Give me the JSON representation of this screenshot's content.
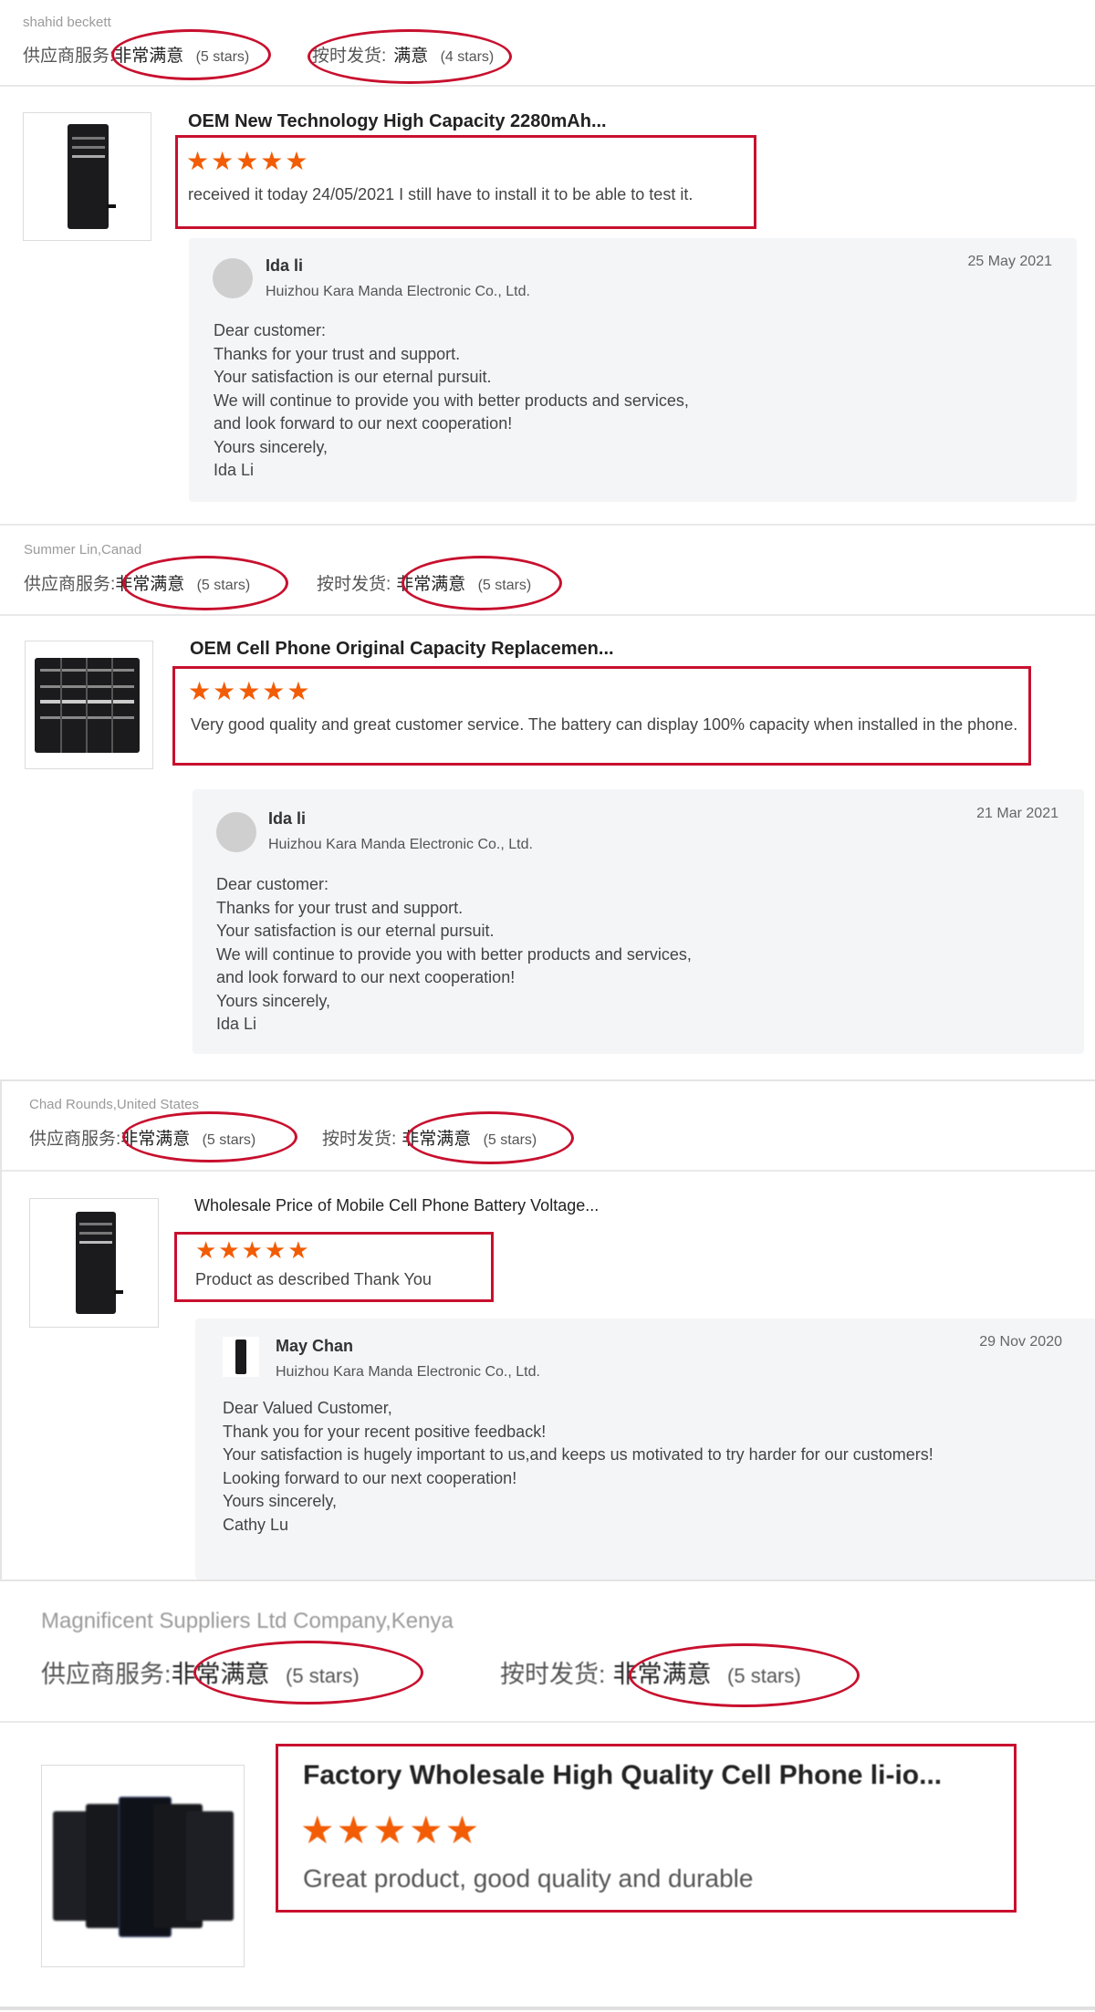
{
  "reviews": [
    {
      "reviewer": "shahid beckett",
      "service_label": "供应商服务:",
      "service_value": "非常满意",
      "service_count": "(5 stars)",
      "shipping_label": "按时发货:",
      "shipping_value": "满意",
      "shipping_count": "(4 stars)",
      "product_title": "OEM New Technology High Capacity 2280mAh...",
      "rating": 5,
      "stars": "★★★★★",
      "comment": "received it today 24/05/2021 I still have to install it to be able to test it.",
      "reply": {
        "name": "Ida li",
        "company": "Huizhou Kara Manda Electronic Co., Ltd.",
        "date": "25 May 2021",
        "message": "Dear customer:\nThanks for your trust and support.\nYour satisfaction is our eternal pursuit.\nWe will continue to provide you with better products and services,\nand look forward to our next cooperation!\nYours sincerely,\nIda Li"
      }
    },
    {
      "reviewer": "Summer Lin,Canad",
      "service_label": "供应商服务:",
      "service_value": "非常满意",
      "service_count": "(5 stars)",
      "shipping_label": "按时发货:",
      "shipping_value": "非常满意",
      "shipping_count": "(5 stars)",
      "product_title": "OEM Cell Phone Original Capacity Replacemen...",
      "rating": 5,
      "stars": "★★★★★",
      "comment": "Very good quality and great customer service. The battery can display 100% capacity when installed in the phone.",
      "reply": {
        "name": "Ida li",
        "company": "Huizhou Kara Manda Electronic Co., Ltd.",
        "date": "21 Mar 2021",
        "message": "Dear customer:\nThanks for your trust and support.\nYour satisfaction is our eternal pursuit.\nWe will continue to provide you with better products and services,\nand look forward to our next cooperation!\nYours sincerely,\nIda Li"
      }
    },
    {
      "reviewer": "Chad Rounds,United States",
      "service_label": "供应商服务:",
      "service_value": "非常满意",
      "service_count": "(5 stars)",
      "shipping_label": "按时发货:",
      "shipping_value": "非常满意",
      "shipping_count": "(5 stars)",
      "product_title": "Wholesale Price of Mobile Cell Phone Battery Voltage...",
      "rating": 5,
      "stars": "★★★★★",
      "comment": "Product as described Thank You",
      "reply": {
        "name": "May Chan",
        "company": "Huizhou Kara Manda Electronic Co., Ltd.",
        "date": "29 Nov 2020",
        "message": "Dear Valued Customer,\nThank you for your recent positive feedback!\nYour satisfaction is hugely important to us,and keeps us motivated to try harder for our customers!\nLooking forward to our next cooperation!\nYours sincerely,\nCathy Lu"
      }
    },
    {
      "reviewer": "Magnificent Suppliers Ltd Company,Kenya",
      "service_label": "供应商服务:",
      "service_value": "非常满意",
      "service_count": "(5 stars)",
      "shipping_label": "按时发货:",
      "shipping_value": "非常满意",
      "shipping_count": "(5 stars)",
      "product_title": "Factory Wholesale High Quality Cell Phone li-io...",
      "rating": 5,
      "stars": "★★★★★",
      "comment": "Great product, good quality and durable"
    }
  ],
  "colors": {
    "star": "#f25c05",
    "annotation": "#c8102e",
    "reply_bg": "#f4f5f7"
  }
}
